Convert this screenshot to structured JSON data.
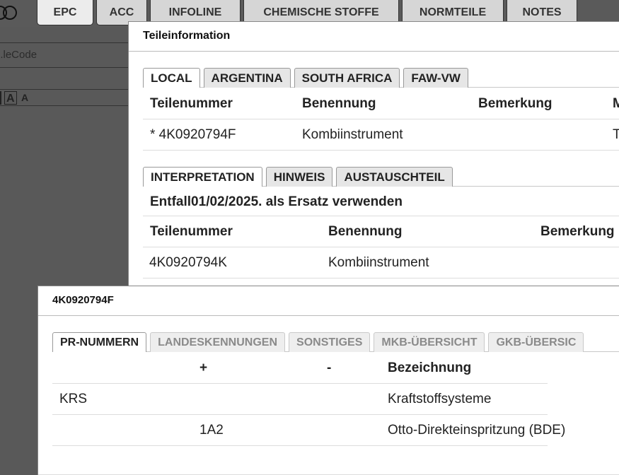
{
  "top_tabs": [
    "EPC",
    "ACC",
    "INFOLINE",
    "CHEMISCHE STOFFE",
    "NORMTEILE",
    "NOTES"
  ],
  "bg_field_placeholder": "...leCode",
  "font_tools": [
    "A",
    "A"
  ],
  "teileinfo": {
    "title": "Teileinformation",
    "market_tabs": [
      "LOCAL",
      "ARGENTINA",
      "SOUTH AFRICA",
      "FAW-VW"
    ],
    "columns": [
      "Teilenummer",
      "Benennung",
      "Bemerkung",
      "M"
    ],
    "row": {
      "teilenummer": "* 4K0920794F",
      "benennung": "Kombiinstrument",
      "bemerkung": "",
      "m": "T"
    },
    "info_tabs": [
      "INTERPRETATION",
      "HINWEIS",
      "AUSTAUSCHTEIL"
    ],
    "entfall_note": "Entfall01/02/2025. als Ersatz verwenden",
    "replacement_columns": [
      "Teilenummer",
      "Benennung",
      "Bemerkung"
    ],
    "replacement_row": {
      "teilenummer": "4K0920794K",
      "benennung": "Kombiinstrument"
    }
  },
  "part_detail": {
    "title": "4K0920794F",
    "tabs": [
      "PR-NUMMERN",
      "LANDESKENNUNGEN",
      "SONSTIGES",
      "MKB-ÜBERSICHT",
      "GKB-ÜBERSIC"
    ],
    "columns": [
      "",
      "+",
      "-",
      "Bezeichnung"
    ],
    "rows": [
      {
        "code": "KRS",
        "plus": "",
        "minus": "",
        "bezeichnung": "Kraftstoffsysteme"
      },
      {
        "code": "",
        "plus": "1A2",
        "minus": "",
        "bezeichnung": "Otto-Direkteinspritzung (BDE)"
      }
    ]
  }
}
